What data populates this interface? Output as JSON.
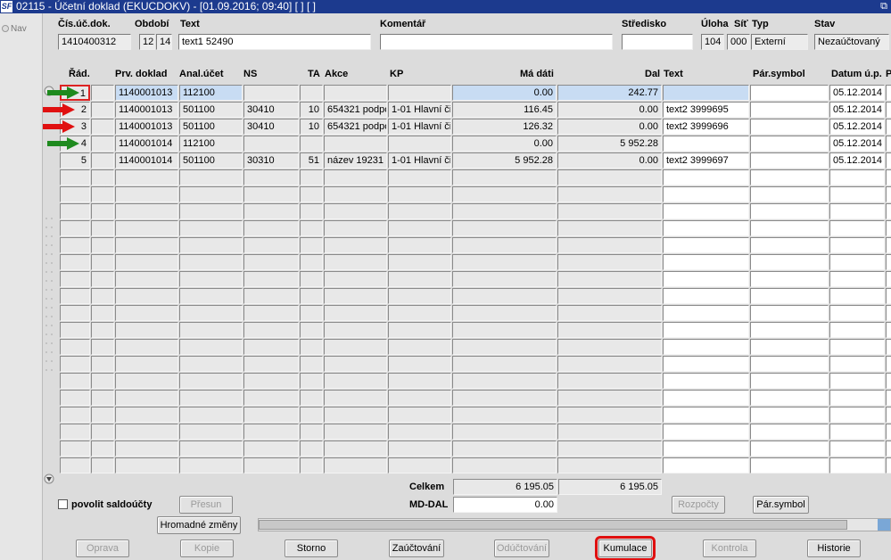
{
  "window": {
    "title": "02115 - Účetní doklad (EKUCDOKV) - [01.09.2016; 09:40]  [ ]  [ ]",
    "logo": "SF",
    "restore_icon": "⧉"
  },
  "sidebar": {
    "nav_label": "Nav"
  },
  "header": {
    "labels": {
      "cis_uc_dok": "Čís.úč.dok.",
      "obdobi": "Období",
      "text": "Text",
      "komentar": "Komentář",
      "stredisko": "Středisko",
      "uloha": "Úloha",
      "sit": "Síť",
      "typ": "Typ",
      "stav": "Stav"
    },
    "values": {
      "cis_uc_dok": "1410400312",
      "obdobi_m": "12",
      "obdobi_y": "14",
      "text": "text1 52490",
      "komentar": "",
      "stredisko": "",
      "uloha": "104",
      "sit": "000",
      "typ": "Externí",
      "stav": "Nezaúčtovaný"
    }
  },
  "grid": {
    "columns": [
      "Řád.",
      "Prv. doklad",
      "Anal.účet",
      "NS",
      "TA",
      "Akce",
      "KP",
      "Má dáti",
      "Dal",
      "Text",
      "Pár.symbol",
      "Datum ú.p.",
      "P"
    ],
    "rows": [
      {
        "rad": "1",
        "prv": "1140001013",
        "anal": "112100",
        "ns": "",
        "ta": "",
        "akce": "",
        "kp": "",
        "md": "0.00",
        "dal": "242.77",
        "text": "",
        "par": "",
        "datum": "05.12.2014",
        "arrow": "green"
      },
      {
        "rad": "2",
        "prv": "1140001013",
        "anal": "501100",
        "ns": "30410",
        "ta": "10",
        "akce": "654321 podpo",
        "kp": "1-01 Hlavní či",
        "md": "116.45",
        "dal": "0.00",
        "text": "text2 3999695",
        "par": "",
        "datum": "05.12.2014",
        "arrow": "red"
      },
      {
        "rad": "3",
        "prv": "1140001013",
        "anal": "501100",
        "ns": "30410",
        "ta": "10",
        "akce": "654321 podpo",
        "kp": "1-01 Hlavní či",
        "md": "126.32",
        "dal": "0.00",
        "text": "text2 3999696",
        "par": "",
        "datum": "05.12.2014",
        "arrow": "red"
      },
      {
        "rad": "4",
        "prv": "1140001014",
        "anal": "112100",
        "ns": "",
        "ta": "",
        "akce": "",
        "kp": "",
        "md": "0.00",
        "dal": "5 952.28",
        "text": "",
        "par": "",
        "datum": "05.12.2014",
        "arrow": "green"
      },
      {
        "rad": "5",
        "prv": "1140001014",
        "anal": "501100",
        "ns": "30310",
        "ta": "51",
        "akce": "název 19231",
        "kp": "1-01 Hlavní či",
        "md": "5 952.28",
        "dal": "0.00",
        "text": "text2 3999697",
        "par": "",
        "datum": "05.12.2014",
        "arrow": ""
      }
    ]
  },
  "totals": {
    "celkem_label": "Celkem",
    "celkem_md": "6 195.05",
    "celkem_dal": "6 195.05",
    "mddal_label": "MD-DAL",
    "mddal_value": "0.00"
  },
  "controls": {
    "povolit_saldoucty": "povolit saldoúčty",
    "presun": "Přesun",
    "rozpocty": "Rozpočty",
    "parsymbol": "Pár.symbol",
    "hromadne_zmeny": "Hromadné změny"
  },
  "footer": {
    "oprava": "Oprava",
    "kopie": "Kopie",
    "storno": "Storno",
    "zauctovani": "Zaúčtování",
    "oductovani": "Odúčtování",
    "kumulace": "Kumulace",
    "kontrola": "Kontrola",
    "historie": "Historie"
  },
  "colors": {
    "titlebar": "#1c3a8e",
    "selected": "#c8dcf3",
    "highlight": "#e01010",
    "arrow_green": "#1e8a1e",
    "arrow_red": "#e01010"
  }
}
